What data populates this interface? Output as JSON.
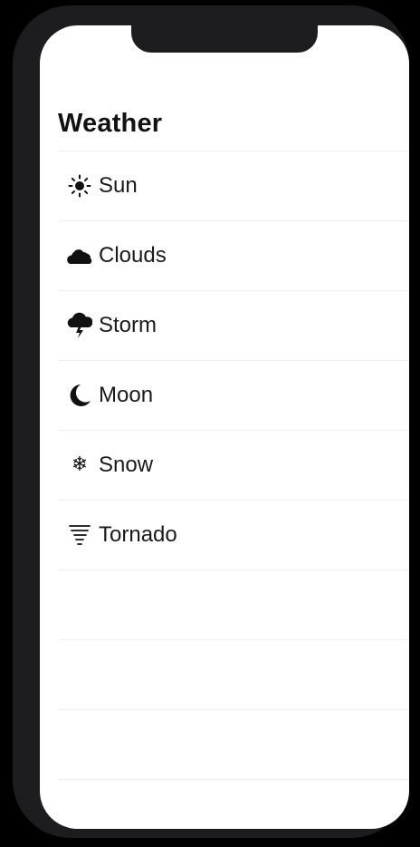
{
  "nav": {
    "title": "Weather"
  },
  "list": {
    "items": [
      {
        "label": "Sun",
        "icon": "sun-icon"
      },
      {
        "label": "Clouds",
        "icon": "clouds-icon"
      },
      {
        "label": "Storm",
        "icon": "storm-icon"
      },
      {
        "label": "Moon",
        "icon": "moon-icon"
      },
      {
        "label": "Snow",
        "icon": "snowflake-icon"
      },
      {
        "label": "Tornado",
        "icon": "tornado-icon"
      }
    ]
  }
}
